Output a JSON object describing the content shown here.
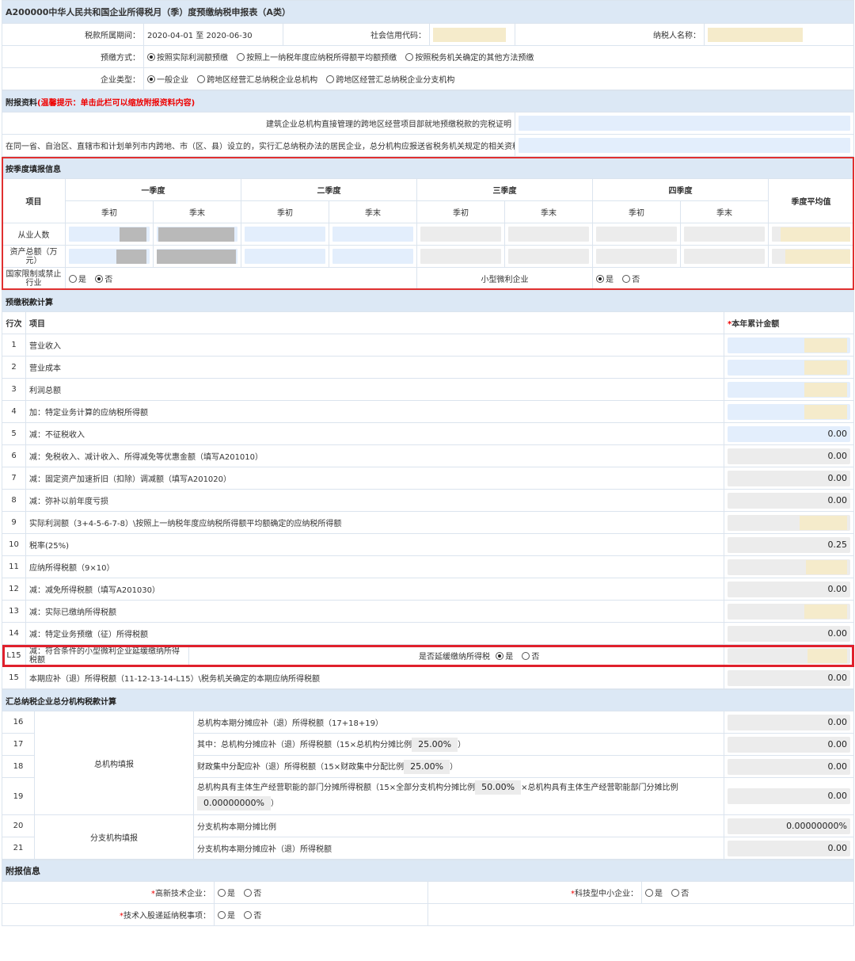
{
  "form_title": "A200000中华人民共和国企业所得税月（季）度预缴纳税申报表（A类）",
  "header": {
    "period_label": "税款所属期间：",
    "period_value": "2020-04-01 至 2020-06-30",
    "credit_code_label": "社会信用代码：",
    "taxpayer_label": "纳税人名称：",
    "prepay_label": "预缴方式：",
    "prepay_options": [
      "按照实际利润额预缴",
      "按照上一纳税年度应纳税所得额平均额预缴",
      "按照税务机关确定的其他方法预缴"
    ],
    "enterprise_label": "企业类型：",
    "enterprise_options": [
      "一般企业",
      "跨地区经营汇总纳税企业总机构",
      "跨地区经营汇总纳税企业分支机构"
    ]
  },
  "attach": {
    "title": "附报资料",
    "hint": "(温馨提示：单击此栏可以缩放附报资料内容)",
    "row1": "建筑企业总机构直接管理的跨地区经营项目部就地预缴税款的完税证明",
    "row2": "在同一省、自治区、直辖市和计划单列市内跨地、市（区、县）设立的，实行汇总纳税办法的居民企业，总分机构应报送省税务机关规定的相关资料"
  },
  "quarter": {
    "title": "按季度填报信息",
    "item_header": "项目",
    "quarters": [
      "一季度",
      "二季度",
      "三季度",
      "四季度"
    ],
    "start": "季初",
    "end": "季末",
    "avg": "季度平均值",
    "rows": [
      "从业人数",
      "资产总额（万元）"
    ],
    "restricted_label": "国家限制或禁止行业",
    "small_label": "小型微利企业",
    "yes": "是",
    "no": "否"
  },
  "calc": {
    "title": "预缴税款计算",
    "col_no": "行次",
    "col_item": "项目",
    "col_amount_star": "*",
    "col_amount": "本年累计金额",
    "rows": [
      {
        "no": "1",
        "item": "营业收入",
        "value": ""
      },
      {
        "no": "2",
        "item": "营业成本",
        "value": ""
      },
      {
        "no": "3",
        "item": "利润总额",
        "value": ""
      },
      {
        "no": "4",
        "item": "加：特定业务计算的应纳税所得额",
        "value": ""
      },
      {
        "no": "5",
        "item": "减：不征税收入",
        "value": "0.00"
      },
      {
        "no": "6",
        "item": "减：免税收入、减计收入、所得减免等优惠金额（填写A201010）",
        "value": "0.00"
      },
      {
        "no": "7",
        "item": "减：固定资产加速折旧（扣除）调减额（填写A201020）",
        "value": "0.00"
      },
      {
        "no": "8",
        "item": "减：弥补以前年度亏损",
        "value": "0.00"
      },
      {
        "no": "9",
        "item": "实际利润额（3+4-5-6-7-8）\\按照上一纳税年度应纳税所得额平均额确定的应纳税所得额",
        "value": ""
      },
      {
        "no": "10",
        "item": "税率(25%)",
        "value": "0.25"
      },
      {
        "no": "11",
        "item": "应纳所得税额（9×10）",
        "value": ""
      },
      {
        "no": "12",
        "item": "减：减免所得税额（填写A201030）",
        "value": "0.00"
      },
      {
        "no": "13",
        "item": "减：实际已缴纳所得税额",
        "value": ""
      },
      {
        "no": "14",
        "item": "减：特定业务预缴（征）所得税额",
        "value": "0.00"
      }
    ],
    "l15_no": "L15",
    "l15_item": "减：符合条件的小型微利企业延缓缴纳所得税额",
    "l15_question": "是否延缓缴纳所得税",
    "row15_no": "15",
    "row15_item": "本期应补（退）所得税额（11-12-13-14-L15）\\税务机关确定的本期应纳所得税额",
    "row15_value": "0.00"
  },
  "summary": {
    "title": "汇总纳税企业总分机构税款计算",
    "hq_label": "总机构填报",
    "branch_label": "分支机构填报",
    "r16": {
      "no": "16",
      "item": "总机构本期分摊应补（退）所得税额（17+18+19）",
      "value": "0.00"
    },
    "r17": {
      "no": "17",
      "item_a": "其中：总机构分摊应补（退）所得税额（15×总机构分摊比例",
      "pct": "25.00%",
      "item_b": "）",
      "value": "0.00"
    },
    "r18": {
      "no": "18",
      "item_a": "财政集中分配应补（退）所得税额（15×财政集中分配比例",
      "pct": "25.00%",
      "item_b": "）",
      "value": "0.00"
    },
    "r19": {
      "no": "19",
      "item_a": "总机构具有主体生产经营职能的部门分摊所得税额（15×全部分支机构分摊比例",
      "pct": "50.00%",
      "item_b": "×总机构具有主体生产经营职能部门分摊比例",
      "pct2": "0.00000000%",
      "item_c": "）",
      "value": "0.00"
    },
    "r20": {
      "no": "20",
      "item": "分支机构本期分摊比例",
      "value": "0.00000000%"
    },
    "r21": {
      "no": "21",
      "item": "分支机构本期分摊应补（退）所得税额",
      "value": "0.00"
    }
  },
  "extra": {
    "title": "附报信息",
    "star": "*",
    "hightech": "高新技术企业：",
    "smalltech": "科技型中小企业：",
    "tech_defer": "技术入股递延纳税事项：",
    "yes": "是",
    "no": "否"
  }
}
